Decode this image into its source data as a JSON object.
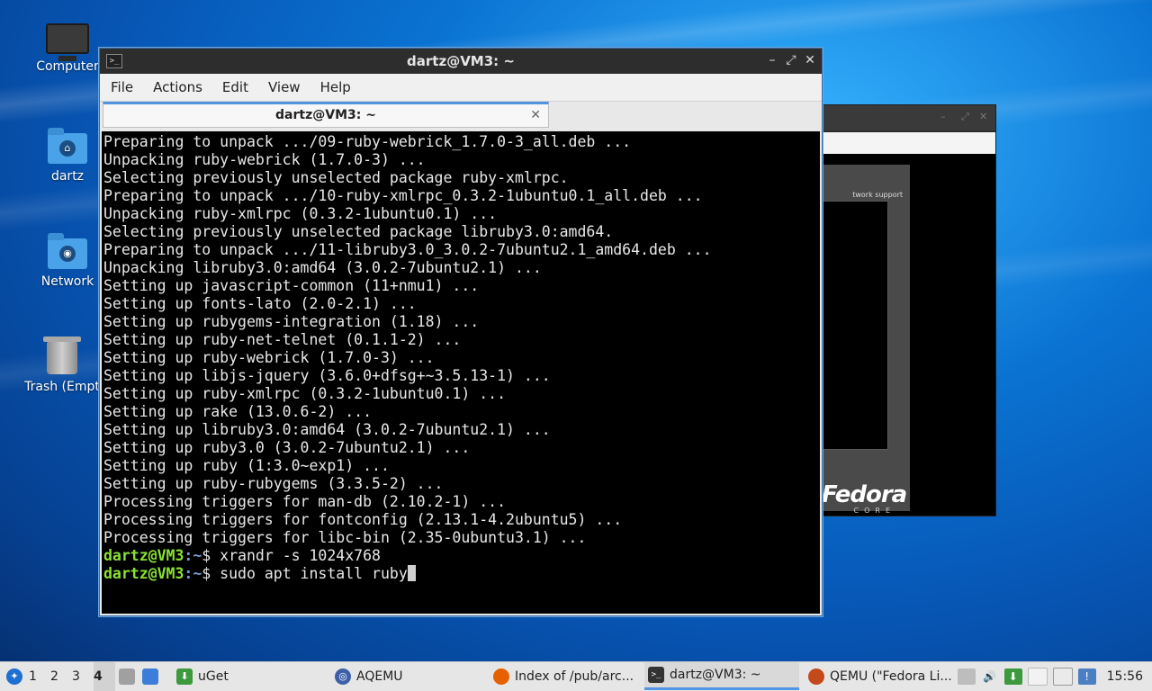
{
  "desktop": {
    "icons": [
      {
        "label": "Computer"
      },
      {
        "label": "dartz"
      },
      {
        "label": "Network"
      },
      {
        "label": "Trash (Empt"
      }
    ]
  },
  "qemu_window": {
    "network_text": "twork support",
    "fedora_logo": "Fedora",
    "fedora_core": "CORE"
  },
  "terminal": {
    "window_title": "dartz@VM3: ~",
    "menu": [
      "File",
      "Actions",
      "Edit",
      "View",
      "Help"
    ],
    "tab_label": "dartz@VM3: ~",
    "lines": [
      "Preparing to unpack .../09-ruby-webrick_1.7.0-3_all.deb ...",
      "Unpacking ruby-webrick (1.7.0-3) ...",
      "Selecting previously unselected package ruby-xmlrpc.",
      "Preparing to unpack .../10-ruby-xmlrpc_0.3.2-1ubuntu0.1_all.deb ...",
      "Unpacking ruby-xmlrpc (0.3.2-1ubuntu0.1) ...",
      "Selecting previously unselected package libruby3.0:amd64.",
      "Preparing to unpack .../11-libruby3.0_3.0.2-7ubuntu2.1_amd64.deb ...",
      "Unpacking libruby3.0:amd64 (3.0.2-7ubuntu2.1) ...",
      "Setting up javascript-common (11+nmu1) ...",
      "Setting up fonts-lato (2.0-2.1) ...",
      "Setting up rubygems-integration (1.18) ...",
      "Setting up ruby-net-telnet (0.1.1-2) ...",
      "Setting up ruby-webrick (1.7.0-3) ...",
      "Setting up libjs-jquery (3.6.0+dfsg+~3.5.13-1) ...",
      "Setting up ruby-xmlrpc (0.3.2-1ubuntu0.1) ...",
      "Setting up rake (13.0.6-2) ...",
      "Setting up libruby3.0:amd64 (3.0.2-7ubuntu2.1) ...",
      "Setting up ruby3.0 (3.0.2-7ubuntu2.1) ...",
      "Setting up ruby (1:3.0~exp1) ...",
      "Setting up ruby-rubygems (3.3.5-2) ...",
      "Processing triggers for man-db (2.10.2-1) ...",
      "Processing triggers for fontconfig (2.13.1-4.2ubuntu5) ...",
      "Processing triggers for libc-bin (2.35-0ubuntu3.1) ..."
    ],
    "prompt_user": "dartz@VM3",
    "prompt_path": ":~",
    "prompt_symbol": "$ ",
    "cmd1": "xrandr -s 1024x768",
    "cmd2": "sudo apt install ruby"
  },
  "taskbar": {
    "workspaces": [
      "1",
      "2",
      "3",
      "4"
    ],
    "active_workspace": "4",
    "tasks": [
      {
        "label": "uGet"
      },
      {
        "label": "AQEMU"
      },
      {
        "label": "Index of /pub/arc..."
      },
      {
        "label": "dartz@VM3: ~"
      },
      {
        "label": "QEMU (\"Fedora Li..."
      }
    ],
    "clock": "15:56"
  }
}
